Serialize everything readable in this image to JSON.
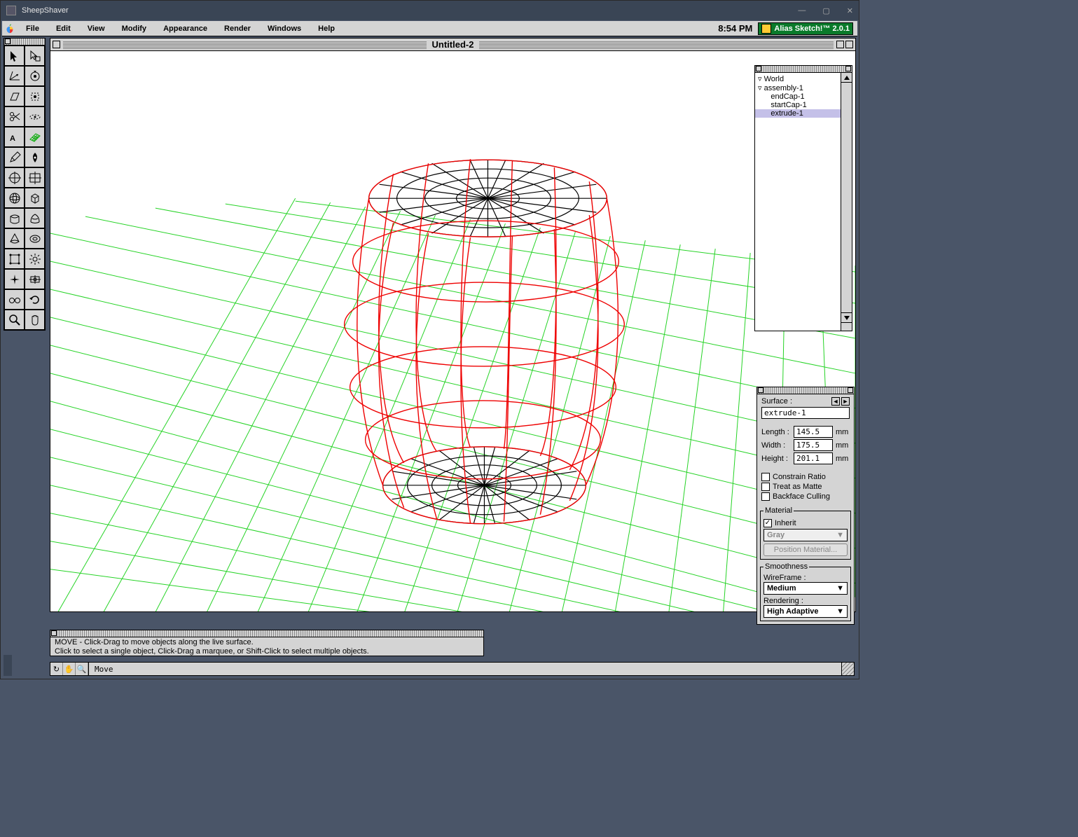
{
  "os": {
    "title": "SheepShaver"
  },
  "menubar": {
    "items": [
      "File",
      "Edit",
      "View",
      "Modify",
      "Appearance",
      "Render",
      "Windows",
      "Help"
    ],
    "clock": "8:54 PM",
    "app": "Alias Sketch!™ 2.0.1"
  },
  "document": {
    "title": "Untitled-2"
  },
  "outliner": {
    "root": "World",
    "items": [
      {
        "label": "assembly-1",
        "indent": 1
      },
      {
        "label": "endCap-1",
        "indent": 2
      },
      {
        "label": "startCap-1",
        "indent": 2
      },
      {
        "label": "extrude-1",
        "indent": 2,
        "selected": true
      }
    ]
  },
  "properties": {
    "header": "Surface :",
    "name": "extrude-1",
    "dims": {
      "length_lbl": "Length :",
      "length": "145.5",
      "width_lbl": "Width :",
      "width": "175.5",
      "height_lbl": "Height :",
      "height": "201.1",
      "unit": "mm"
    },
    "checks": {
      "constrain": "Constrain Ratio",
      "matte": "Treat as Matte",
      "cull": "Backface Culling"
    },
    "material": {
      "legend": "Material",
      "inherit": "Inherit",
      "inherit_checked": true,
      "value": "Gray",
      "button": "Position Material..."
    },
    "smoothness": {
      "legend": "Smoothness",
      "wire_lbl": "WireFrame :",
      "wire": "Medium",
      "rend_lbl": "Rendering :",
      "rend": "High Adaptive"
    }
  },
  "hint": {
    "line1": "MOVE - Click-Drag to move objects along the live surface.",
    "line2": "Click to select a single object, Click-Drag a marquee, or Shift-Click to select multiple objects."
  },
  "status": {
    "mode": "Move"
  },
  "tools": [
    [
      "arrow",
      "Arrow"
    ],
    [
      "arrow-box",
      "Direct"
    ],
    [
      "move3d",
      "Move"
    ],
    [
      "rotate3d",
      "Rotate"
    ],
    [
      "skew",
      "Skew"
    ],
    [
      "selectlasso",
      "Lasso"
    ],
    [
      "scissors",
      "Cut"
    ],
    [
      "ring",
      "Revolve"
    ],
    [
      "text",
      "Text"
    ],
    [
      "gridplane",
      "Plane"
    ],
    [
      "pencil",
      "Pencil"
    ],
    [
      "pen",
      "Pen"
    ],
    [
      "circlecross",
      "Circle"
    ],
    [
      "rectcross",
      "Rect"
    ],
    [
      "sphere",
      "Sphere"
    ],
    [
      "cube",
      "Cube"
    ],
    [
      "extrude1",
      "Extrude"
    ],
    [
      "extrude2",
      "Loft"
    ],
    [
      "cone",
      "Cone"
    ],
    [
      "torus",
      "Torus"
    ],
    [
      "patch1",
      "Patch"
    ],
    [
      "light",
      "Light"
    ],
    [
      "sparkle",
      "Sparkle"
    ],
    [
      "target",
      "Camera"
    ],
    [
      "glasses",
      "View"
    ],
    [
      "cycle",
      "Refresh"
    ],
    [
      "zoom",
      "Zoom"
    ],
    [
      "hand",
      "Pan"
    ]
  ]
}
